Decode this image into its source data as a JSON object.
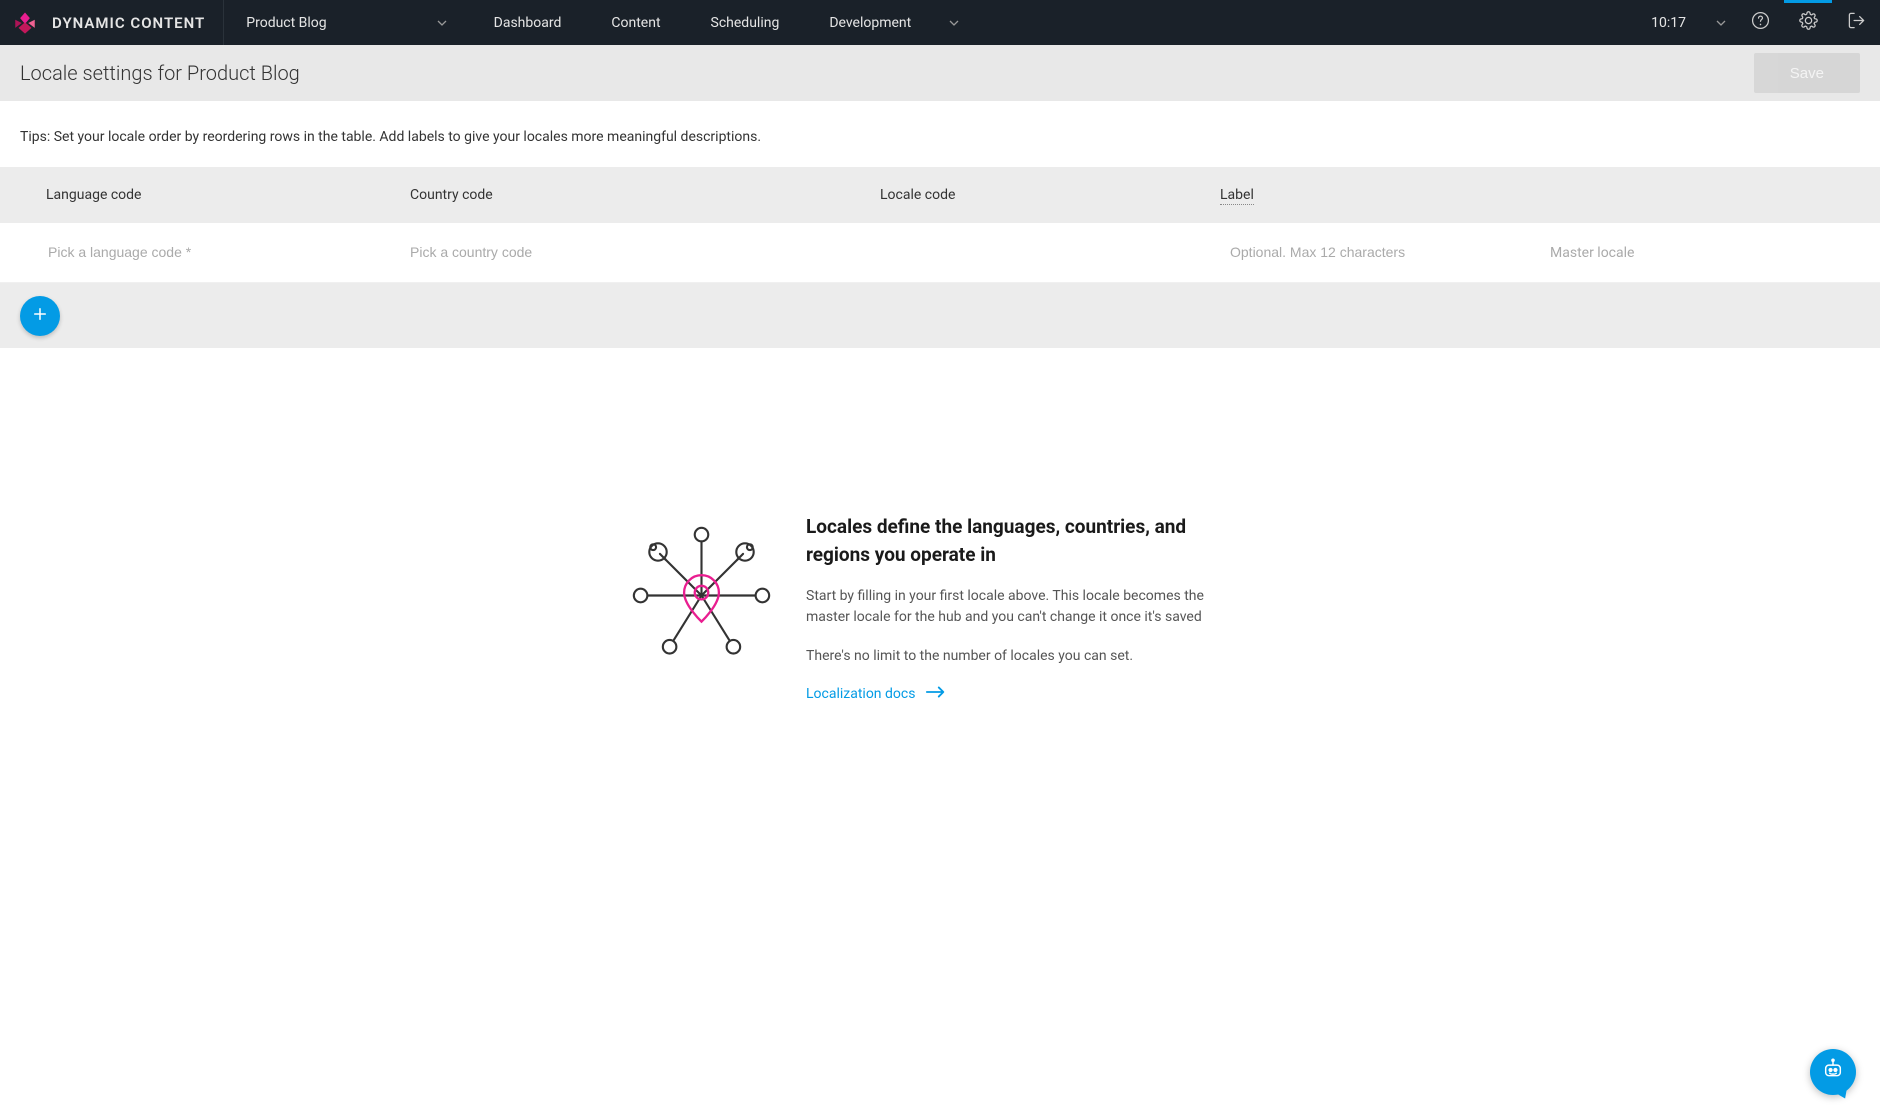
{
  "brand": {
    "name": "DYNAMIC CONTENT"
  },
  "hub": {
    "name": "Product Blog"
  },
  "nav": {
    "dashboard": "Dashboard",
    "content": "Content",
    "scheduling": "Scheduling",
    "development": "Development"
  },
  "time": "10:17",
  "subheader": {
    "title": "Locale settings for Product Blog",
    "save": "Save"
  },
  "tips": "Tips: Set your locale order by reordering rows in the table. Add labels to give your locales more meaningful descriptions.",
  "columns": {
    "language": "Language code",
    "country": "Country code",
    "locale": "Locale code",
    "label": "Label"
  },
  "row": {
    "language_ph": "Pick a language code *",
    "country_ph": "Pick a country code",
    "label_ph": "Optional. Max 12 characters",
    "master": "Master locale"
  },
  "hero": {
    "title": "Locales define the languages, countries, and regions you operate in",
    "p1": "Start by filling in your first locale above. This locale becomes the master locale for the hub and you can't change it once it's saved",
    "p2": "There's no limit to the number of locales you can set.",
    "link": "Localization docs"
  }
}
